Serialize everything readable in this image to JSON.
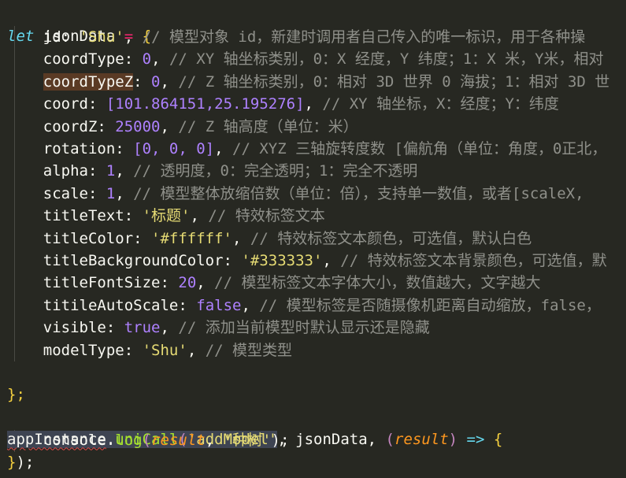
{
  "code": {
    "l1": {
      "keyword": "let",
      "name": "jsonData",
      "eq": "=",
      "open": "{"
    },
    "props": [
      {
        "key": "id",
        "value": "'Shu'",
        "vtype": "str",
        "comment": "// 模型对象 id，新建时调用者自己传入的唯一标识，用于各种操"
      },
      {
        "key": "coordType",
        "value": "0",
        "vtype": "num",
        "comment": "// XY 轴坐标类别，0：X 经度，Y 纬度；1：X 米，Y米，相对"
      },
      {
        "key": "coordTypeZ",
        "value": "0",
        "vtype": "num",
        "comment": "// Z 轴坐标类别，0：相对 3D 世界 0 海拔；1：相对 3D 世"
      },
      {
        "key": "coord",
        "value": "[101.864151,25.195276]",
        "vtype": "arr",
        "comment": "// XY 轴坐标，X：经度；Y：纬度"
      },
      {
        "key": "coordZ",
        "value": "25000",
        "vtype": "num",
        "comment": "// Z 轴高度（单位：米）"
      },
      {
        "key": "rotation",
        "value": "[0, 0, 0]",
        "vtype": "arr",
        "comment": "// XYZ 三轴旋转度数 [偏航角（单位：角度，0正北，"
      },
      {
        "key": "alpha",
        "value": "1",
        "vtype": "num",
        "comment": "// 透明度，0：完全透明；1：完全不透明"
      },
      {
        "key": "scale",
        "value": "1",
        "vtype": "num",
        "comment": "// 模型整体放缩倍数（单位：倍），支持单一数值，或者[scaleX,"
      },
      {
        "key": "titleText",
        "value": "'标题'",
        "vtype": "str",
        "comment": "// 特效标签文本"
      },
      {
        "key": "titleColor",
        "value": "'#ffffff'",
        "vtype": "str",
        "comment": "// 特效标签文本颜色，可选值，默认白色"
      },
      {
        "key": "titleBackgroundColor",
        "value": "'#333333'",
        "vtype": "str",
        "comment": "// 特效标签文本背景颜色，可选值，默"
      },
      {
        "key": "titleFontSize",
        "value": "20",
        "vtype": "num",
        "comment": "// 模型标签文本字体大小，数值越大，文字越大"
      },
      {
        "key": "titileAutoScale",
        "value": "false",
        "vtype": "num",
        "comment": "// 模型标签是否随摄像机距离自动缩放，false，"
      },
      {
        "key": "visible",
        "value": "true",
        "vtype": "num",
        "comment": "// 添加当前模型时默认显示还是隐藏"
      },
      {
        "key": "modelType",
        "value": "'Shu'",
        "vtype": "str",
        "comment": "// 模型类型"
      }
    ],
    "close1": "};",
    "call": {
      "obj": "appInstance",
      "dot": ".",
      "method": "uniCall",
      "open": "(",
      "arg1": "'addModel'",
      "comma1": ",",
      "arg2": "jsonData",
      "comma2": ",",
      "popen": "(",
      "param": "result",
      "pclose": ")",
      "arrow": "=>",
      "brace": "{"
    },
    "inner": {
      "obj": "console",
      "dot": ".",
      "method": "log",
      "open": "(",
      "param": "result",
      "comma": ",",
      "str": "'种树'",
      "close": ");"
    },
    "close2": {
      "brace": "}",
      "rest": ");"
    }
  },
  "colors": {
    "background": "#272822",
    "keyword": "#66d9ef",
    "string": "#e6db74",
    "number": "#ae81ff",
    "comment": "#8f908a",
    "operator": "#f92672",
    "function": "#a6e22e",
    "parameter": "#fd971f"
  }
}
